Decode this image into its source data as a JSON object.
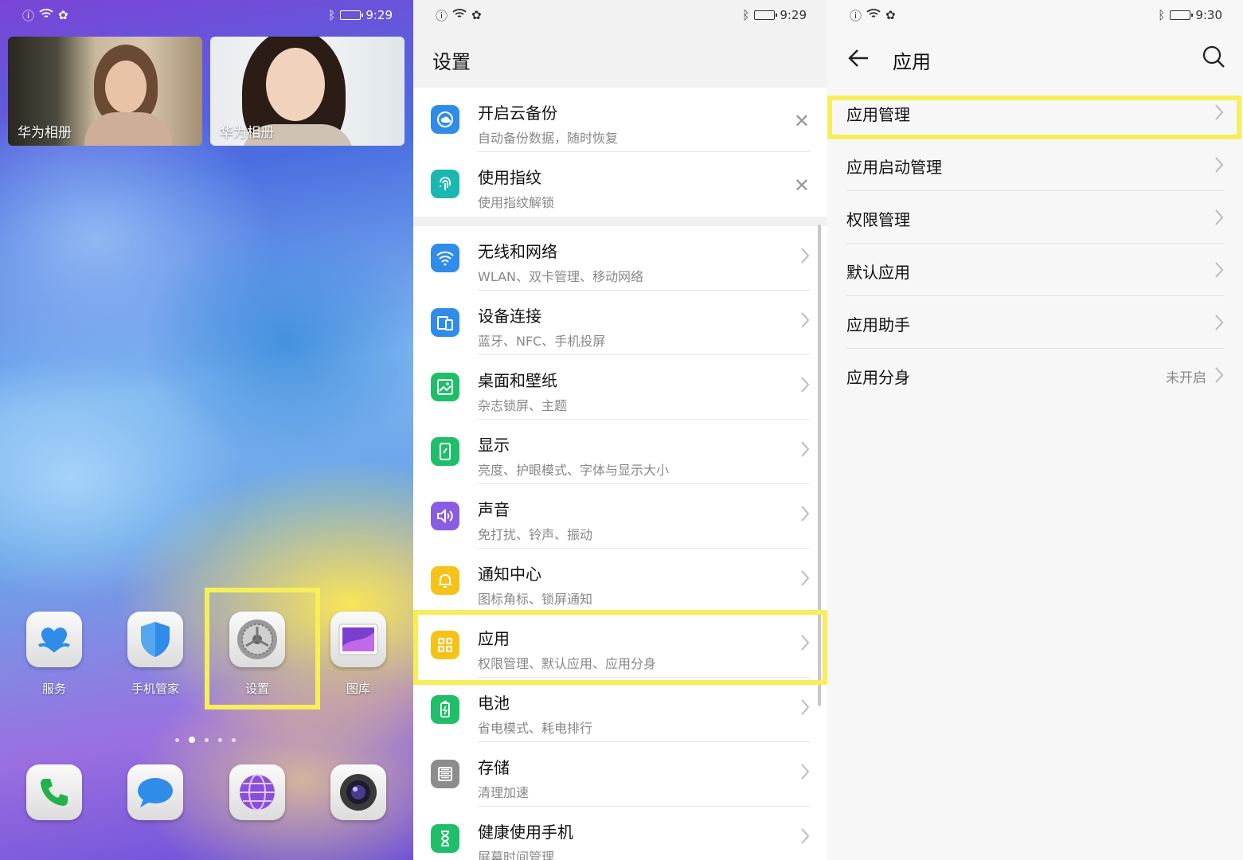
{
  "home": {
    "status": {
      "time": "9:29"
    },
    "widgets": [
      {
        "label": "华为相册"
      },
      {
        "label": "华为相册"
      }
    ],
    "apps": [
      {
        "label": "服务",
        "icon": "service-heart-icon"
      },
      {
        "label": "手机管家",
        "icon": "shield-icon"
      },
      {
        "label": "设置",
        "icon": "gear-icon"
      },
      {
        "label": "图库",
        "icon": "gallery-icon"
      }
    ],
    "dock": [
      {
        "icon": "phone-icon"
      },
      {
        "icon": "messages-icon"
      },
      {
        "icon": "browser-globe-icon"
      },
      {
        "icon": "camera-icon"
      }
    ],
    "page_dots": 5,
    "active_dot": 1
  },
  "settings": {
    "status": {
      "time": "9:29"
    },
    "title": "设置",
    "suggestions": [
      {
        "title": "开启云备份",
        "subtitle": "自动备份数据，随时恢复",
        "icon": "cloud-backup-icon",
        "color": "#2f8ce8"
      },
      {
        "title": "使用指纹",
        "subtitle": "使用指纹解锁",
        "icon": "fingerprint-icon",
        "color": "#19b8b0"
      }
    ],
    "items": [
      {
        "title": "无线和网络",
        "subtitle": "WLAN、双卡管理、移动网络",
        "icon": "wifi-icon",
        "color": "#2f8ce8"
      },
      {
        "title": "设备连接",
        "subtitle": "蓝牙、NFC、手机投屏",
        "icon": "device-connect-icon",
        "color": "#2f8ce8"
      },
      {
        "title": "桌面和壁纸",
        "subtitle": "杂志锁屏、主题",
        "icon": "wallpaper-icon",
        "color": "#1fbf6a"
      },
      {
        "title": "显示",
        "subtitle": "亮度、护眼模式、字体与显示大小",
        "icon": "display-icon",
        "color": "#1fbf6a"
      },
      {
        "title": "声音",
        "subtitle": "免打扰、铃声、振动",
        "icon": "sound-icon",
        "color": "#8a5ce0"
      },
      {
        "title": "通知中心",
        "subtitle": "图标角标、锁屏通知",
        "icon": "bell-icon",
        "color": "#f5c318"
      },
      {
        "title": "应用",
        "subtitle": "权限管理、默认应用、应用分身",
        "icon": "apps-grid-icon",
        "color": "#f5c318"
      },
      {
        "title": "电池",
        "subtitle": "省电模式、耗电排行",
        "icon": "battery-icon",
        "color": "#1fbf6a"
      },
      {
        "title": "存储",
        "subtitle": "清理加速",
        "icon": "storage-icon",
        "color": "#8c8c8c"
      },
      {
        "title": "健康使用手机",
        "subtitle": "屏幕时间管理",
        "icon": "hourglass-icon",
        "color": "#1fbf6a"
      }
    ]
  },
  "apps_page": {
    "status": {
      "time": "9:30"
    },
    "title": "应用",
    "items": [
      {
        "label": "应用管理",
        "value": ""
      },
      {
        "label": "应用启动管理",
        "value": ""
      },
      {
        "label": "权限管理",
        "value": ""
      },
      {
        "label": "默认应用",
        "value": ""
      },
      {
        "label": "应用助手",
        "value": ""
      },
      {
        "label": "应用分身",
        "value": "未开启"
      }
    ]
  },
  "colors": {
    "highlight": "#f6ee5a"
  }
}
